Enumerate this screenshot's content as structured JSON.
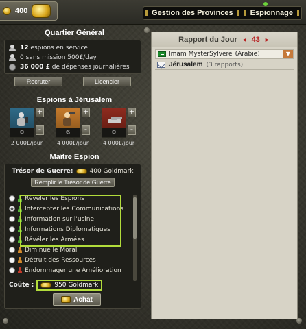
{
  "topbar": {
    "gold": "400",
    "tabs": [
      "Gestion des Provinces",
      "Espionnage"
    ]
  },
  "hq": {
    "title": "Quartier Général",
    "spies_count": "12",
    "spies_text": "espions en service",
    "idle_count": "0",
    "idle_text": "sans mission 500£/day",
    "expenses_amount": "36 000 £",
    "expenses_text": "de dépenses journalières",
    "recruit_label": "Recruter",
    "dismiss_label": "Licencier"
  },
  "spies": {
    "title": "Espions à Jérusalem",
    "units": [
      {
        "count": "0",
        "cost": "2 000£/jour",
        "color": "#2f6a87"
      },
      {
        "count": "6",
        "cost": "4 000£/jour",
        "color": "#c57a2c"
      },
      {
        "count": "0",
        "cost": "4 000£/jour",
        "color": "#8e2b1f"
      }
    ]
  },
  "master": {
    "title": "Maître Espion",
    "treasury_label": "Trésor de Guerre:",
    "treasury_value": "400 Goldmark",
    "fill_label": "Remplir le Trésor de Guerre",
    "missions": [
      {
        "label": "Révéler les Espions",
        "color": "green",
        "selected": false
      },
      {
        "label": "Intercepter les Communications",
        "color": "green",
        "selected": true
      },
      {
        "label": "Information sur l'usine",
        "color": "green",
        "selected": false
      },
      {
        "label": "Informations Diplomatiques",
        "color": "green",
        "selected": false
      },
      {
        "label": "Révéler les Armées",
        "color": "green",
        "selected": false
      },
      {
        "label": "Diminue le Moral",
        "color": "orange",
        "selected": false
      },
      {
        "label": "Détruit des Ressources",
        "color": "orange",
        "selected": false
      },
      {
        "label": "Endommager une Amélioration",
        "color": "red",
        "selected": false
      }
    ],
    "cost_label": "Coûte :",
    "cost_value": "950 Goldmark",
    "buy_label": "Achat"
  },
  "report": {
    "title": "Rapport du Jour",
    "prev": "◄",
    "count": "43",
    "next": "►",
    "item1": "Imam MysterSylvere",
    "item1_sub": "(Arabie)",
    "item2": "Jérusalem",
    "item2_sub": "(3 rapports)"
  },
  "colors": {
    "highlight": "#b2dc3b",
    "alert_red": "#b72020"
  }
}
